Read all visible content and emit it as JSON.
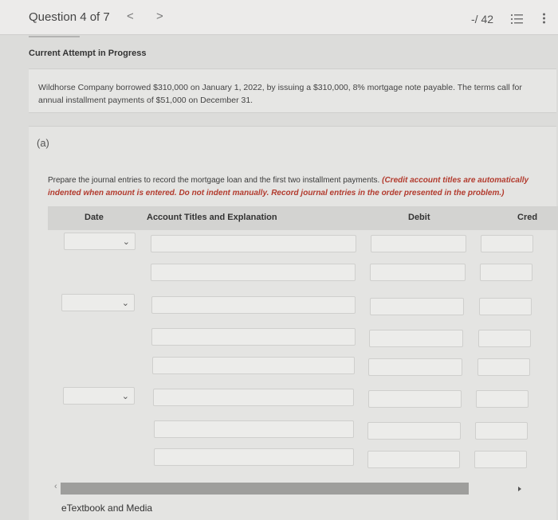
{
  "header": {
    "question_label": "Question 4 of 7",
    "prev_glyph": "<",
    "next_glyph": ">",
    "score": "-/ 42"
  },
  "attempt_status": "Current Attempt in Progress",
  "problem": {
    "text": "Wildhorse Company borrowed $310,000 on January 1, 2022, by issuing a $310,000, 8% mortgage note payable. The terms call for annual installment payments of $51,000 on December 31."
  },
  "part": {
    "label": "(a)",
    "instructions": "Prepare the journal entries to record the mortgage loan and the first two installment payments.",
    "instructions_note": "(Credit account titles are automatically indented when amount is entered. Do not indent manually. Record journal entries in the order presented in the problem.)"
  },
  "journal_table": {
    "columns": {
      "date": "Date",
      "account": "Account Titles and Explanation",
      "debit": "Debit",
      "credit": "Cred"
    },
    "date_chevron": "⌄"
  },
  "footer": {
    "etextbook": "eTextbook and Media"
  },
  "icons": {
    "list": "list-icon",
    "more": "more-vertical-icon"
  }
}
